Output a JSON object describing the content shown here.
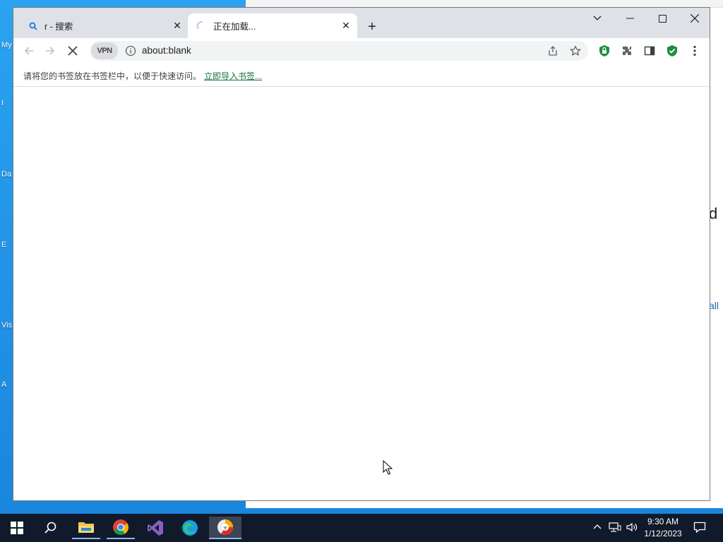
{
  "desktop": {
    "icon_labels": [
      "My",
      "I",
      "Da",
      "E",
      "Vis",
      "A"
    ],
    "bg_window_fragments": {
      "heading_char": "d",
      "link_text": "all"
    }
  },
  "browser": {
    "tabs": [
      {
        "title": "r - 搜索",
        "icon": "search-icon",
        "state": "inactive"
      },
      {
        "title": "正在加载...",
        "icon": "loading-spinner-icon",
        "state": "active"
      }
    ],
    "new_tab_label": "+",
    "toolbar": {
      "vpn_label": "VPN",
      "url": "about:blank",
      "back_enabled": false,
      "forward_enabled": false,
      "loading": true
    },
    "bookmarks_bar": {
      "prompt_text": "请将您的书签放在书签栏中，以便于快速访问。",
      "import_link": "立即导入书签..."
    }
  },
  "taskbar": {
    "apps": [
      "start-icon",
      "search-icon",
      "file-explorer-icon",
      "chrome-icon",
      "visual-studio-icon",
      "edge-icon",
      "browser-icon"
    ],
    "clock": {
      "time": "9:30 AM",
      "date": "1/12/2023"
    }
  },
  "colors": {
    "accent_green": "#1a7340",
    "taskbar_bg": "#101a2a",
    "desktop_bg": "#1a86de"
  }
}
